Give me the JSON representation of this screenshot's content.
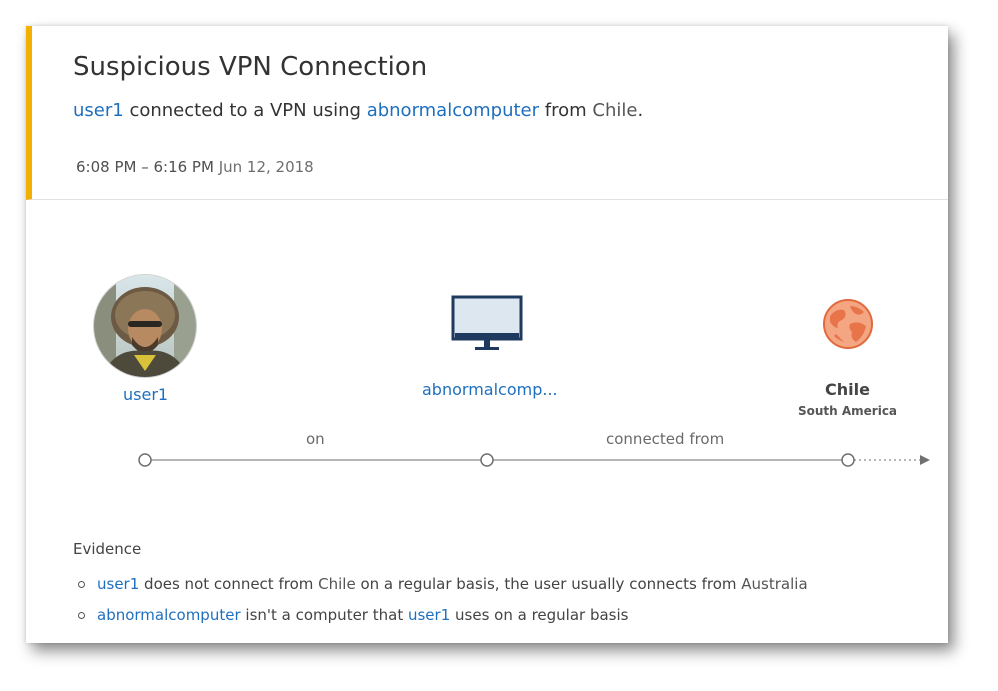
{
  "alert": {
    "title": "Suspicious VPN Connection",
    "summary": {
      "user": "user1",
      "text1": "connected to a VPN using",
      "computer": "abnormalcomputer",
      "text2": "from",
      "country": "Chile",
      "end": "."
    },
    "time_range": "6:08 PM – 6:16 PM",
    "date": "Jun 12, 2018",
    "accent_color": "#f2b000"
  },
  "graph": {
    "user": {
      "label": "user1",
      "icon": "user-avatar"
    },
    "computer": {
      "label": "abnormalcomp...",
      "icon": "monitor-icon"
    },
    "location": {
      "label": "Chile",
      "sublabel": "South America",
      "icon": "globe-icon"
    },
    "edges": [
      "on",
      "connected from"
    ]
  },
  "evidence": {
    "title": "Evidence",
    "items": [
      {
        "user": "user1",
        "text1": "does not connect from",
        "country": "Chile",
        "text2": "on a regular basis, the user usually connects from",
        "usual_country": "Australia"
      },
      {
        "computer": "abnormalcomputer",
        "text1": "isn't a computer that",
        "user": "user1",
        "text2": "uses on a regular basis"
      }
    ]
  },
  "colors": {
    "link": "#1f6fbf",
    "globe": "#e8744a"
  }
}
